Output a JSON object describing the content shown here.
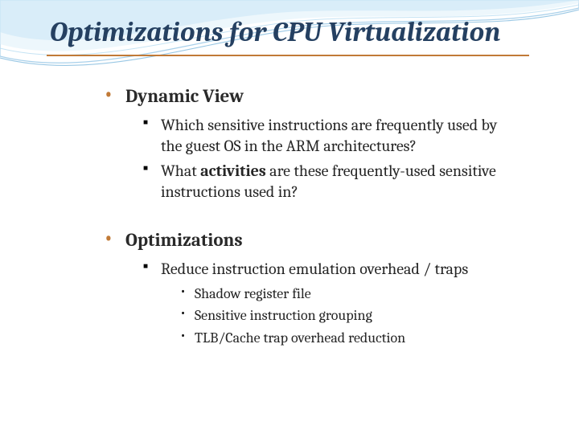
{
  "title": "Optimizations for CPU Virtualization",
  "sections": [
    {
      "heading": "Dynamic View",
      "sub": [
        {
          "text_html": "Which sensitive instructions are frequently used by the guest OS in the ARM architectures?"
        },
        {
          "text_html": "What <span class='bold'>activities</span> are these frequently-used sensitive instructions used in?"
        }
      ]
    },
    {
      "heading": "Optimizations",
      "sub": [
        {
          "text_html": "Reduce instruction emulation overhead / traps",
          "sub": [
            {
              "text": "Shadow register file"
            },
            {
              "text": "Sensitive instruction grouping"
            },
            {
              "text": "TLB/Cache trap overhead reduction"
            }
          ]
        }
      ]
    }
  ]
}
